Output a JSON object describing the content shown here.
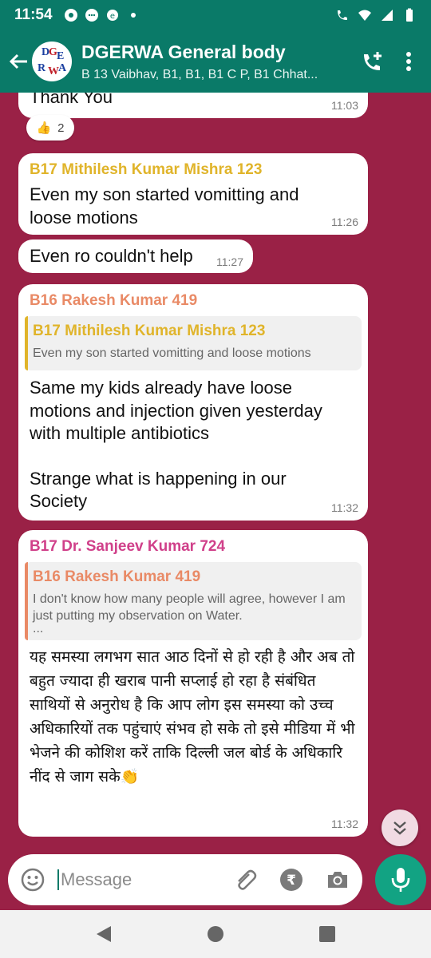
{
  "status": {
    "time": "11:54"
  },
  "header": {
    "title": "DGERWA General body",
    "subtitle": "B 13 Vaibhav, B1, B1, B1 C P, B1 Chhat...",
    "avatar_letters": [
      "D",
      "G",
      "E",
      "R",
      "W",
      "A"
    ]
  },
  "messages": [
    {
      "text": "Thank You",
      "time": "11:03",
      "reaction_count": "2"
    },
    {
      "sender": "B17 Mithilesh Kumar Mishra 123",
      "text": "Even my son started vomitting and loose motions",
      "time": "11:26"
    },
    {
      "text": "Even ro couldn't help",
      "time": "11:27"
    },
    {
      "sender": "B16 Rakesh Kumar 419",
      "quote_sender": "B17 Mithilesh Kumar Mishra 123",
      "quote_text": "Even my son started vomitting and loose motions",
      "line1": "Same my kids already have loose motions and injection given yesterday with multiple antibiotics",
      "line2": "Strange what is happening in our Society",
      "time": "11:32"
    },
    {
      "sender": "B17 Dr. Sanjeev Kumar 724",
      "quote_sender": "B16 Rakesh Kumar 419",
      "quote_text": "I don't know how many people will agree, however I am just putting my observation on Water.",
      "quote_more": "...",
      "text": "यह समस्या लगभग सात आठ दिनों से हो रही है और अब तो बहुत ज्यादा ही खराब पानी सप्लाई हो रहा है संबंधित साथियों से अनुरोध है कि आप लोग इस समस्या को उच्च अधिकारियों तक पहुंचाएं संभव हो सके तो इसे मीडिया में भी भेजने की कोशिश करें ताकि दिल्ली जल बोर्ड के अधिकारि नींद से जाग सके👏",
      "time": "11:32"
    }
  ],
  "input": {
    "placeholder": "Message"
  },
  "colors": {
    "header": "#0a7a68",
    "background": "#9a2146",
    "mic": "#12a383",
    "sender_yellow": "#e0b42a",
    "sender_orange": "#e98a66",
    "sender_pink": "#d0408a"
  }
}
